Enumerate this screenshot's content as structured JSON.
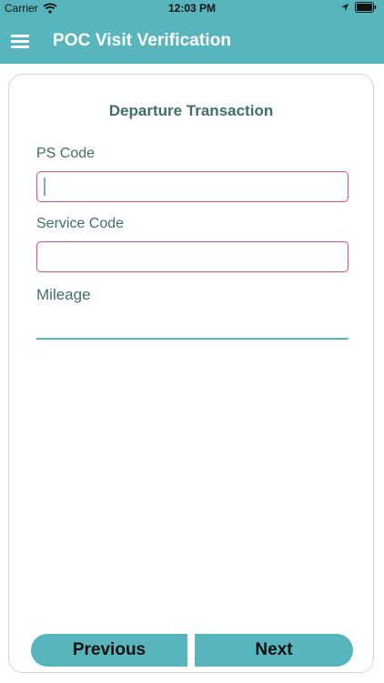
{
  "status_bar": {
    "carrier": "Carrier",
    "time": "12:03 PM",
    "icons": [
      "wifi-icon",
      "location-arrow-icon",
      "battery-icon"
    ]
  },
  "header": {
    "title": "POC Visit Verification",
    "menu_icon": "hamburger-menu-icon",
    "background_color": "#58b5be"
  },
  "form": {
    "title": "Departure Transaction",
    "fields": [
      {
        "label": "PS Code",
        "value": "",
        "placeholder": ""
      },
      {
        "label": "Service Code",
        "value": "",
        "placeholder": ""
      },
      {
        "label": "Mileage",
        "value": "",
        "placeholder": ""
      }
    ]
  },
  "buttons": {
    "previous_label": "Previous",
    "next_label": "Next"
  },
  "colors": {
    "accent": "#58b5be",
    "label_text": "#3f6f66",
    "error_border": "#e1506a"
  }
}
